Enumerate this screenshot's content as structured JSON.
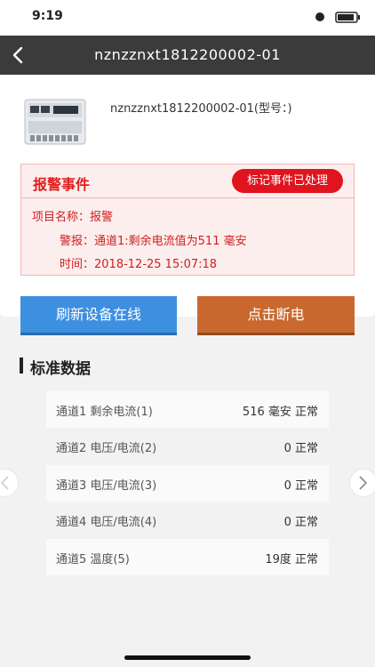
{
  "status_bar": {
    "time": "9:19"
  },
  "nav": {
    "title": "nznzznxt1812200002-01"
  },
  "device": {
    "title": "nznzznxt1812200002-01(型号：)"
  },
  "alarm": {
    "title": "报警事件",
    "mark_button": "标记事件已处理",
    "project_line": "项目名称：报警",
    "alert_line": "警报：通道1:剩余电流值为511 毫安",
    "time_line": "时间：2018-12-25 15:07:18"
  },
  "actions": {
    "refresh_label": "刷新设备在线",
    "cutoff_label": "点击断电"
  },
  "standard_data": {
    "title": "标准数据",
    "rows": [
      {
        "label": "通道1 剩余电流(1)",
        "value": "516 毫安  正常"
      },
      {
        "label": "通道2 电压/电流(2)",
        "value": "0  正常"
      },
      {
        "label": "通道3 电压/电流(3)",
        "value": "0  正常"
      },
      {
        "label": "通道4 电压/电流(4)",
        "value": "0  正常"
      },
      {
        "label": "通道5 温度(5)",
        "value": "19度  正常"
      }
    ]
  },
  "colors": {
    "nav_bg": "#3b3b3b",
    "alarm_red": "#e0141e",
    "refresh_blue": "#3d8fe0",
    "cutoff_orange": "#c9692f"
  }
}
